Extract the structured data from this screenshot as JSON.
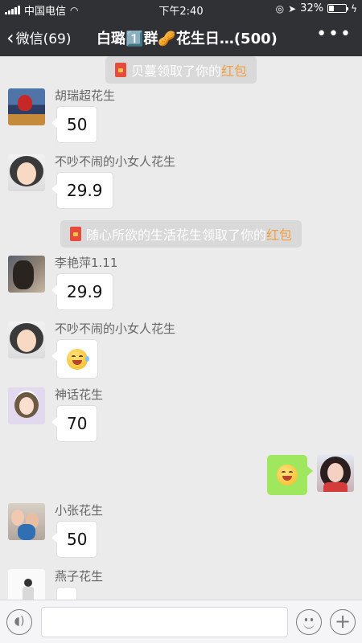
{
  "status": {
    "carrier": "中国电信",
    "time": "下午2:40",
    "battery": "32%"
  },
  "nav": {
    "back_label": "微信(69)",
    "title": "白璐1️⃣群🥜花生日…(500)"
  },
  "system_1": {
    "name": "贝蔓",
    "text": "领取了你的",
    "highlight": "红包"
  },
  "system_2": {
    "name": "随心所欲的生活花生",
    "text": "领取了你的",
    "highlight": "红包"
  },
  "messages": [
    {
      "nick": "胡瑞超花生",
      "text": "50"
    },
    {
      "nick": "不吵不闹的小女人花生",
      "text": "29.9"
    },
    {
      "nick": "李艳萍1.11",
      "text": "29.9"
    },
    {
      "nick": "不吵不闹的小女人花生",
      "emoji": "laughing-tears-emoji"
    },
    {
      "nick": "神话花生",
      "text": "70"
    },
    {
      "nick": "小张花生",
      "text": "50"
    },
    {
      "nick": "燕子花生",
      "text": ""
    }
  ],
  "outgoing": {
    "emoji": "smile-emoji"
  },
  "input": {
    "placeholder": ""
  }
}
